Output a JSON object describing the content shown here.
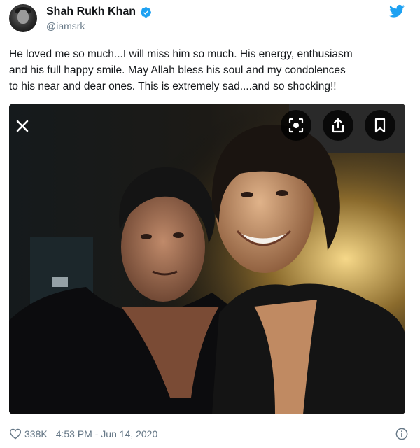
{
  "tweet": {
    "author": {
      "display_name": "Shah Rukh Khan",
      "handle": "@iamsrk",
      "verified": true
    },
    "text_lines": [
      "He loved me so much...I will miss him so much. His energy, enthusiasm",
      "and his full happy smile. May Allah bless his soul and my condolences",
      "to his near and dear ones. This is extremely sad....and so shocking!!"
    ],
    "likes": "338K",
    "timestamp": "4:53 PM - Jun 14, 2020"
  },
  "icons": {
    "platform": "twitter-bird-icon",
    "verified": "verified-badge-icon",
    "close": "close-icon",
    "lens": "visual-search-icon",
    "share": "share-icon",
    "bookmark": "bookmark-icon",
    "like": "heart-icon",
    "info": "info-icon"
  },
  "colors": {
    "brand_blue": "#1da1f2",
    "text_primary": "#14171a",
    "text_secondary": "#657786"
  }
}
